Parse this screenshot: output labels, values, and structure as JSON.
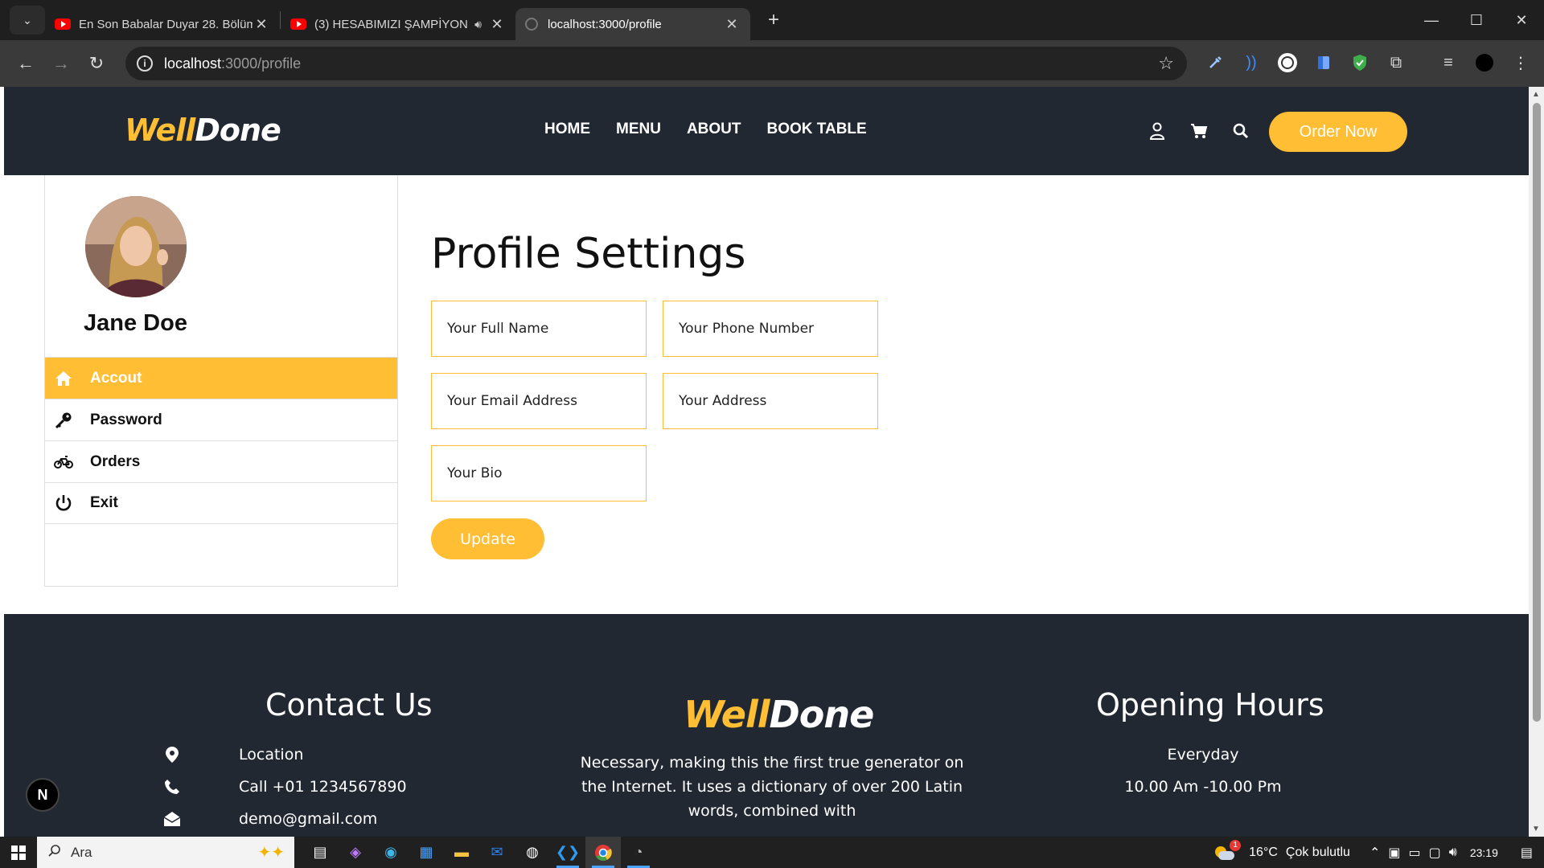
{
  "browser": {
    "tabs": [
      {
        "title": "En Son Babalar Duyar 28. Bölüm",
        "type": "youtube"
      },
      {
        "title": "(3) HESABIMIZI ŞAMPİYON…",
        "type": "youtube",
        "audio": true
      },
      {
        "title": "localhost:3000/profile",
        "type": "page",
        "active": true
      }
    ],
    "address": {
      "host": "localhost",
      "path": ":3000/profile"
    }
  },
  "header": {
    "logo": {
      "part1": "Well",
      "part2": "Done"
    },
    "nav": [
      "HOME",
      "MENU",
      "ABOUT",
      "BOOK TABLE"
    ],
    "order_label": "Order Now"
  },
  "sidebar": {
    "username": "Jane Doe",
    "items": [
      {
        "label": "Accout",
        "icon": "home-icon",
        "active": true
      },
      {
        "label": "Password",
        "icon": "key-icon"
      },
      {
        "label": "Orders",
        "icon": "bicycle-icon"
      },
      {
        "label": "Exit",
        "icon": "power-icon"
      }
    ]
  },
  "profile": {
    "title": "Profile Settings",
    "fields": {
      "full_name": "Your Full Name",
      "phone": "Your Phone Number",
      "email": "Your Email Address",
      "address": "Your Address",
      "bio": "Your Bio"
    },
    "update_label": "Update"
  },
  "footer": {
    "contact": {
      "title": "Contact Us",
      "location": "Location",
      "phone": "Call +01 1234567890",
      "email": "demo@gmail.com"
    },
    "logo": {
      "part1": "Well",
      "part2": "Done"
    },
    "description": "Necessary, making this the first true generator on the Internet. It uses a dictionary of over 200 Latin words, combined with",
    "hours": {
      "title": "Opening Hours",
      "days": "Everyday",
      "time": "10.00 Am -10.00 Pm"
    }
  },
  "dev_badge": "N",
  "taskbar": {
    "search_placeholder": "Ara",
    "weather_temp": "16°C",
    "weather_desc": "Çok bulutlu",
    "weather_badge": "1",
    "time": "23:19"
  },
  "colors": {
    "accent": "#ffbe33",
    "dark": "#222831"
  }
}
